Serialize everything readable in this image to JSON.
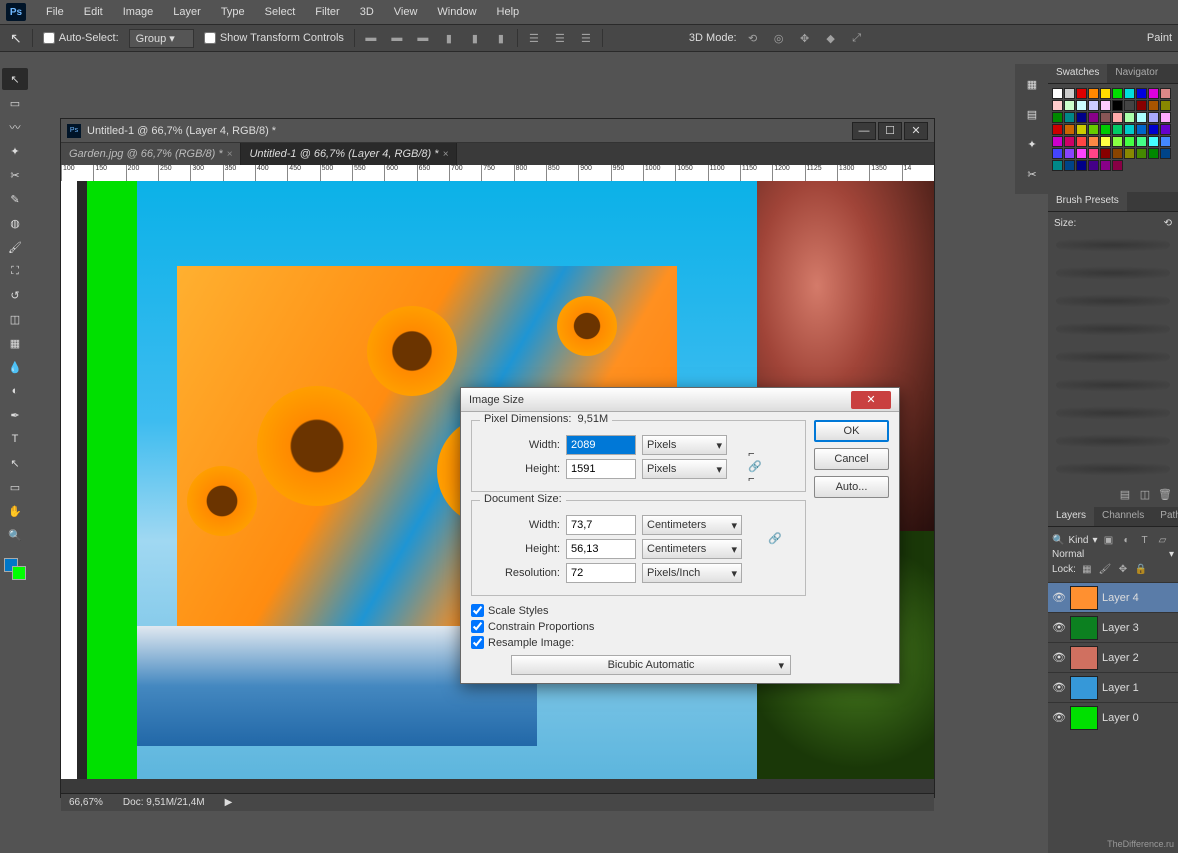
{
  "menu": [
    "File",
    "Edit",
    "Image",
    "Layer",
    "Type",
    "Select",
    "Filter",
    "3D",
    "View",
    "Window",
    "Help"
  ],
  "options": {
    "auto_select": "Auto-Select:",
    "group": "Group",
    "show_transform": "Show Transform Controls",
    "mode_3d": "3D Mode:",
    "paint": "Paint"
  },
  "doc_window": {
    "title": "Untitled-1 @ 66,7% (Layer 4, RGB/8) *",
    "tab1": "Garden.jpg @ 66,7% (RGB/8) *",
    "tab2": "Untitled-1 @ 66,7% (Layer 4, RGB/8) *",
    "ruler_ticks": [
      "100",
      "150",
      "200",
      "250",
      "300",
      "350",
      "400",
      "450",
      "500",
      "550",
      "600",
      "650",
      "700",
      "750",
      "800",
      "850",
      "900",
      "950",
      "1000",
      "1050",
      "1100",
      "1150",
      "1200",
      "1125",
      "1300",
      "1350",
      "14"
    ],
    "zoom": "66,67%",
    "doc_info": "Doc: 9,51M/21,4M"
  },
  "dialog": {
    "title": "Image Size",
    "pixel_dim": "Pixel Dimensions:",
    "pixel_dim_val": "9,51M",
    "doc_size": "Document Size:",
    "width_label": "Width:",
    "height_label": "Height:",
    "res_label": "Resolution:",
    "px_w": "2089",
    "px_h": "1591",
    "unit_px": "Pixels",
    "doc_w": "73,7",
    "doc_h": "56,13",
    "unit_cm": "Centimeters",
    "res_val": "72",
    "unit_res": "Pixels/Inch",
    "ok": "OK",
    "cancel": "Cancel",
    "auto": "Auto...",
    "scale_styles": "Scale Styles",
    "constrain": "Constrain Proportions",
    "resample": "Resample Image:",
    "method": "Bicubic Automatic"
  },
  "panels": {
    "swatches": "Swatches",
    "navigator": "Navigator",
    "brush_presets": "Brush Presets",
    "size": "Size:",
    "layers": "Layers",
    "channels": "Channels",
    "paths": "Path",
    "kind": "Kind",
    "normal": "Normal",
    "lock": "Lock:",
    "layers_list": [
      "Layer 4",
      "Layer 3",
      "Layer 2",
      "Layer 1",
      "Layer 0"
    ]
  },
  "swatch_colors": [
    "#fff",
    "#ccc",
    "#d00",
    "#f80",
    "#fd0",
    "#0d0",
    "#0dd",
    "#00d",
    "#d0d",
    "#d88",
    "#fcc",
    "#cfc",
    "#cff",
    "#ccf",
    "#fcf",
    "#000",
    "#444",
    "#800",
    "#a50",
    "#880",
    "#080",
    "#088",
    "#008",
    "#808",
    "#855",
    "#faa",
    "#afa",
    "#aff",
    "#aaf",
    "#faf",
    "#c00",
    "#c60",
    "#cc0",
    "#6c0",
    "#0c0",
    "#0c6",
    "#0cc",
    "#06c",
    "#00c",
    "#60c",
    "#c0c",
    "#c06",
    "#f44",
    "#f84",
    "#ff4",
    "#8f4",
    "#4f4",
    "#4f8",
    "#4ff",
    "#48f",
    "#44f",
    "#84f",
    "#f4f",
    "#f48",
    "#800",
    "#840",
    "#880",
    "#480",
    "#080",
    "#048",
    "#088",
    "#048",
    "#008",
    "#408",
    "#808",
    "#804"
  ],
  "watermark": "TheDifference.ru"
}
